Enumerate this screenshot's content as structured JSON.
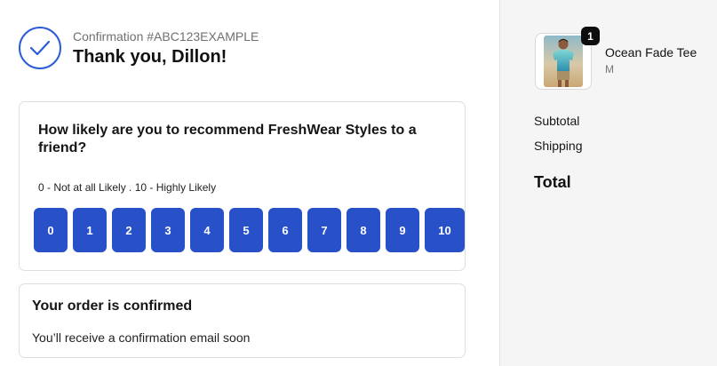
{
  "header": {
    "confirmation": "Confirmation #ABC123EXAMPLE",
    "greeting": "Thank you, Dillon!"
  },
  "survey": {
    "question": "How likely are you to recommend FreshWear Styles to a friend?",
    "scale_legend": "0 - Not at all Likely . 10 - Highly Likely",
    "options": [
      "0",
      "1",
      "2",
      "3",
      "4",
      "5",
      "6",
      "7",
      "8",
      "9",
      "10"
    ]
  },
  "confirmation_card": {
    "title": "Your order is confirmed",
    "subtitle": "You’ll receive a confirmation email soon"
  },
  "sidebar": {
    "item": {
      "name": "Ocean Fade Tee",
      "variant": "M",
      "quantity": "1"
    },
    "subtotal_label": "Subtotal",
    "shipping_label": "Shipping",
    "total_label": "Total"
  },
  "colors": {
    "accent": "#2750c9",
    "check_ring": "#2c5dd6",
    "sidebar_bg": "#f5f5f5"
  }
}
